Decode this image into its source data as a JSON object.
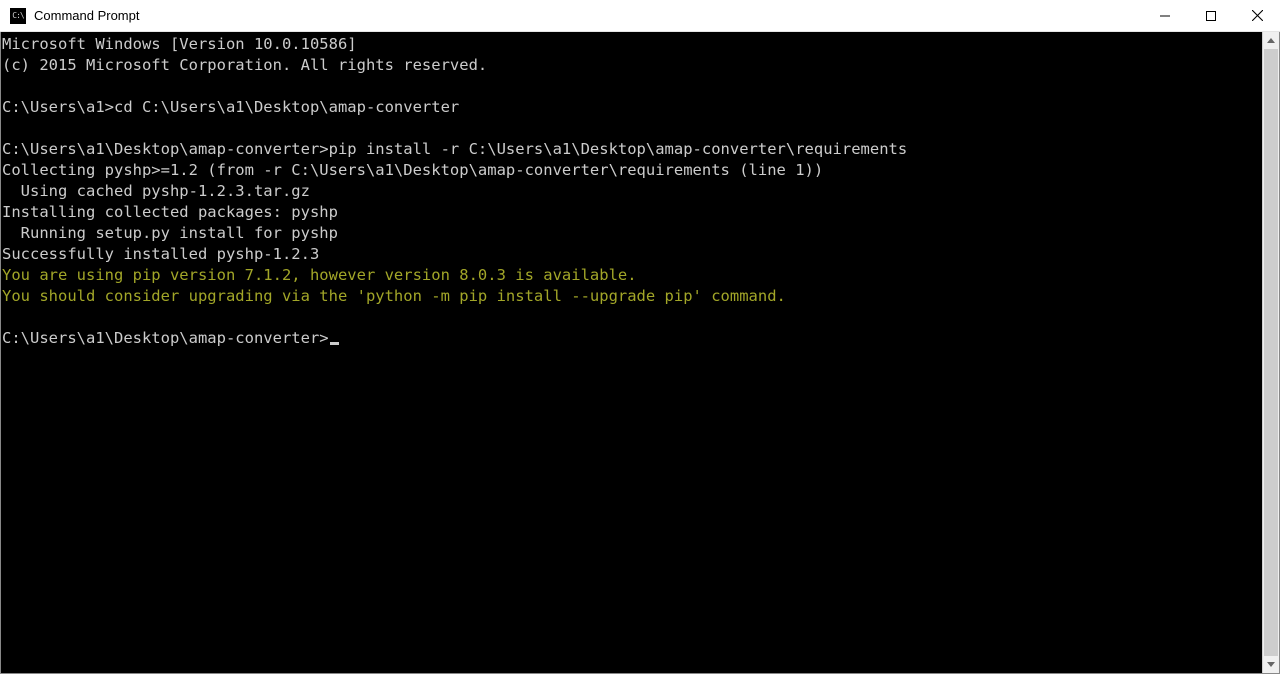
{
  "window": {
    "title": "Command Prompt",
    "icon_label": "C:\\"
  },
  "terminal": {
    "lines": [
      {
        "t": "Microsoft Windows [Version 10.0.10586]"
      },
      {
        "t": "(c) 2015 Microsoft Corporation. All rights reserved."
      },
      {
        "t": ""
      },
      {
        "t": "C:\\Users\\a1>cd C:\\Users\\a1\\Desktop\\amap-converter"
      },
      {
        "t": ""
      },
      {
        "t": "C:\\Users\\a1\\Desktop\\amap-converter>pip install -r C:\\Users\\a1\\Desktop\\amap-converter\\requirements"
      },
      {
        "t": "Collecting pyshp>=1.2 (from -r C:\\Users\\a1\\Desktop\\amap-converter\\requirements (line 1))"
      },
      {
        "t": "  Using cached pyshp-1.2.3.tar.gz"
      },
      {
        "t": "Installing collected packages: pyshp"
      },
      {
        "t": "  Running setup.py install for pyshp"
      },
      {
        "t": "Successfully installed pyshp-1.2.3"
      },
      {
        "t": "You are using pip version 7.1.2, however version 8.0.3 is available.",
        "c": "warn"
      },
      {
        "t": "You should consider upgrading via the 'python -m pip install --upgrade pip' command.",
        "c": "warn"
      },
      {
        "t": ""
      }
    ],
    "prompt": "C:\\Users\\a1\\Desktop\\amap-converter>"
  }
}
